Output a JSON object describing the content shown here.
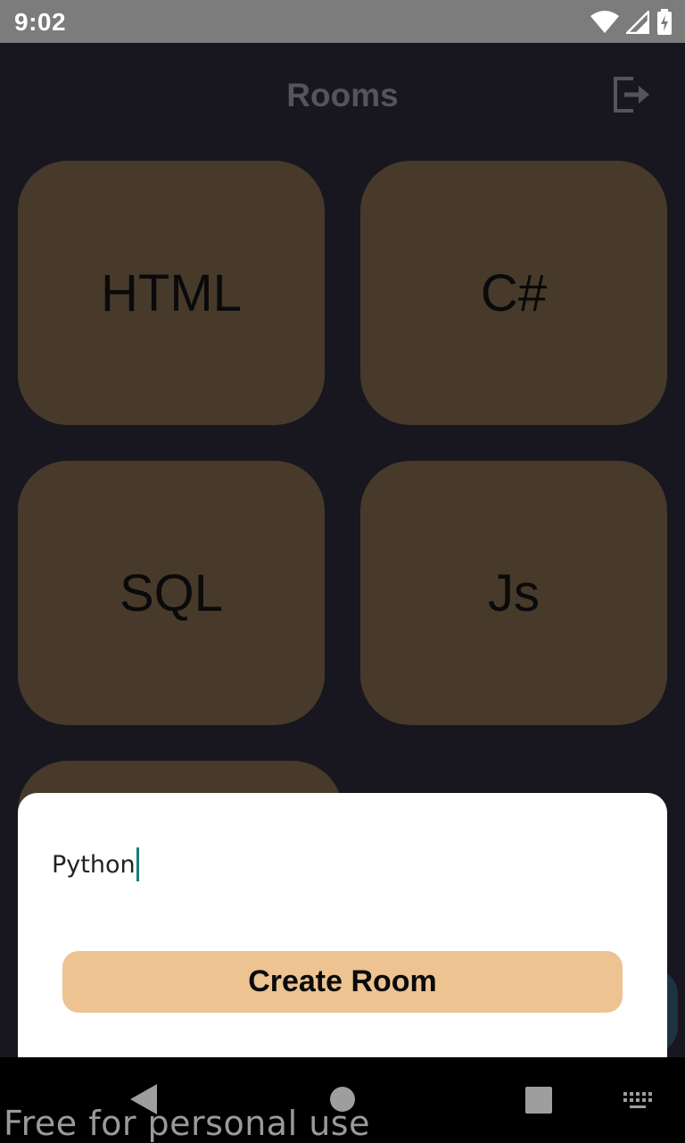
{
  "status_bar": {
    "time": "9:02",
    "icons": [
      "wifi-icon",
      "cell-signal-icon",
      "battery-icon"
    ]
  },
  "header": {
    "title": "Rooms",
    "logout_icon": "logout-icon"
  },
  "rooms": [
    {
      "label": "HTML"
    },
    {
      "label": "C#"
    },
    {
      "label": "SQL"
    },
    {
      "label": "Js"
    },
    {
      "label": ""
    }
  ],
  "dialog": {
    "input_value": "Python",
    "button_label": "Create Room"
  },
  "nav": {
    "icons": [
      "back-icon",
      "home-icon",
      "recents-icon",
      "keyboard-icon"
    ]
  },
  "watermark": "Free for personal use",
  "colors": {
    "background": "#18161f",
    "tile": "#473a2b",
    "accent_button": "#ecc391",
    "caret": "#1a7f73"
  }
}
